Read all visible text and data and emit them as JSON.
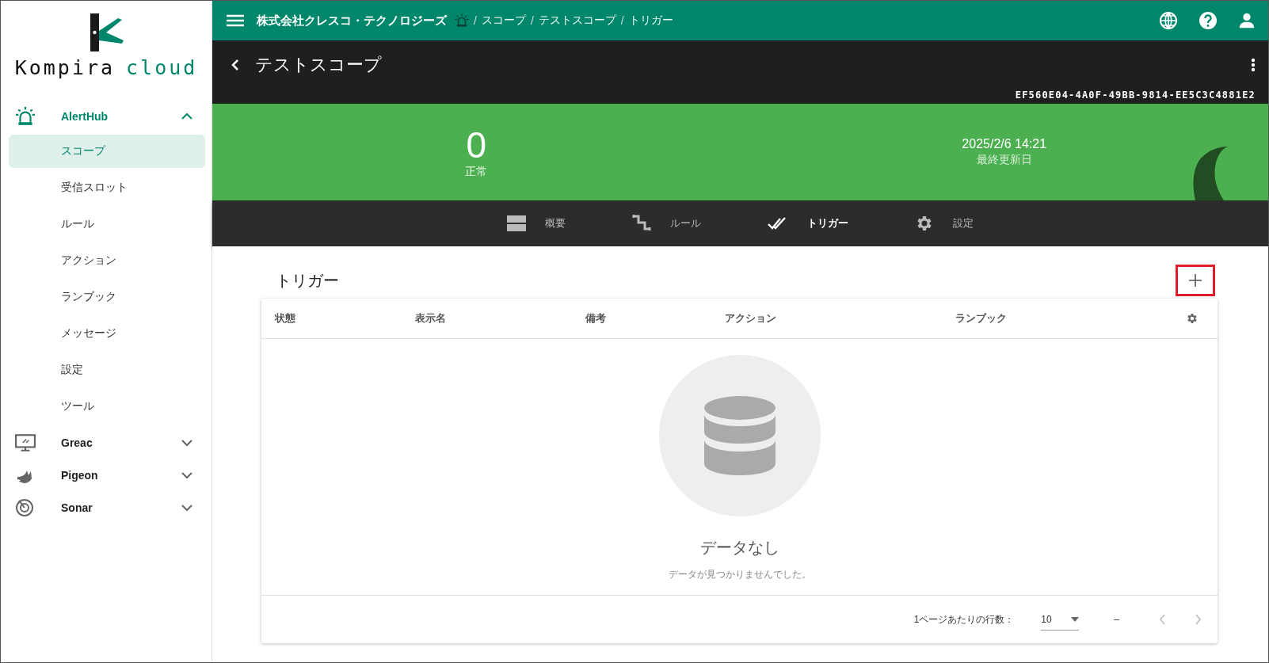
{
  "sidebar": {
    "logo": {
      "word_1": "Kompira",
      "word_2": "cloud"
    },
    "groups": [
      {
        "label": "AlertHub",
        "expanded": true,
        "items": [
          {
            "label": "スコープ",
            "selected": true
          },
          {
            "label": "受信スロット",
            "selected": false
          },
          {
            "label": "ルール",
            "selected": false
          },
          {
            "label": "アクション",
            "selected": false
          },
          {
            "label": "ランブック",
            "selected": false
          },
          {
            "label": "メッセージ",
            "selected": false
          },
          {
            "label": "設定",
            "selected": false
          },
          {
            "label": "ツール",
            "selected": false
          }
        ]
      },
      {
        "label": "Greac",
        "expanded": false
      },
      {
        "label": "Pigeon",
        "expanded": false
      },
      {
        "label": "Sonar",
        "expanded": false
      }
    ]
  },
  "top_bar": {
    "organization": "株式会社クレスコ・テクノロジーズ",
    "separator": "/",
    "breadcrumbs": [
      "スコープ",
      "テストスコープ",
      "トリガー"
    ]
  },
  "header": {
    "title": "テストスコープ",
    "id": "EF560E04-4A0F-49BB-9814-EE5C3C4881E2"
  },
  "status": {
    "count": "0",
    "count_label": "正常",
    "updated": "2025/2/6 14:21",
    "updated_label": "最終更新日"
  },
  "tabs": [
    {
      "label": "概要",
      "selected": false
    },
    {
      "label": "ルール",
      "selected": false
    },
    {
      "label": "トリガー",
      "selected": true
    },
    {
      "label": "設定",
      "selected": false
    }
  ],
  "section": {
    "title": "トリガー",
    "add_button": {
      "highlighted": true
    }
  },
  "table": {
    "columns": [
      "状態",
      "表示名",
      "備考",
      "アクション",
      "ランブック"
    ],
    "empty": {
      "title": "データなし",
      "message": "データが見つかりませんでした。"
    },
    "pagination": {
      "rows_label": "1ページあたりの行数：",
      "rows_per_page": "10",
      "range": "–"
    }
  }
}
